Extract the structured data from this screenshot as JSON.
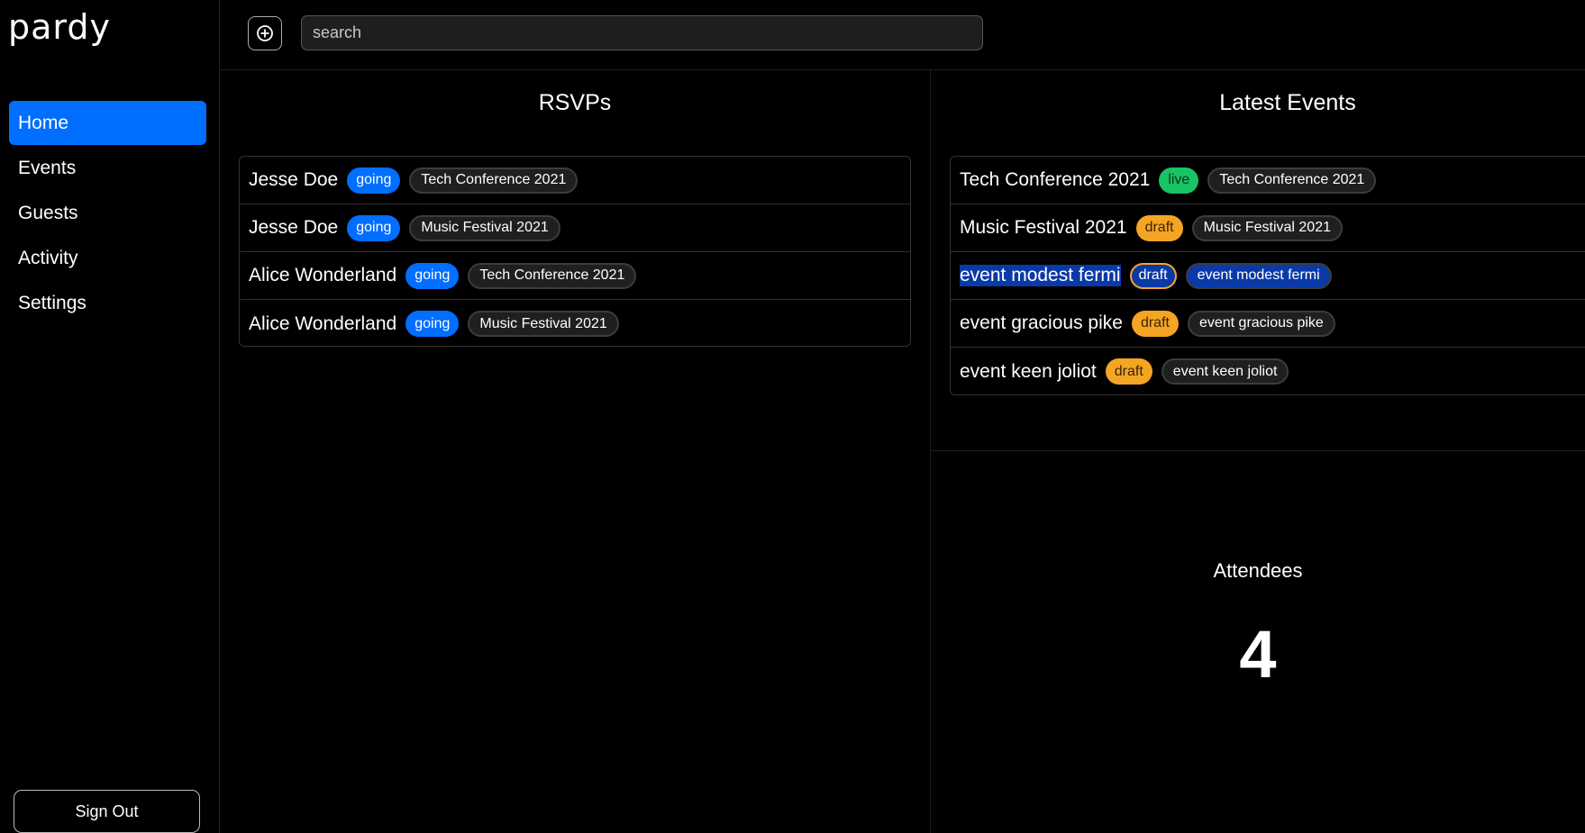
{
  "app": {
    "logo": "pardy"
  },
  "sidebar": {
    "items": [
      {
        "label": "Home",
        "active": true
      },
      {
        "label": "Events"
      },
      {
        "label": "Guests"
      },
      {
        "label": "Activity"
      },
      {
        "label": "Settings"
      }
    ],
    "sign_out": "Sign Out"
  },
  "topbar": {
    "add_icon": "plus-circle-icon",
    "search_placeholder": "search"
  },
  "rsvps": {
    "title": "RSVPs",
    "rows": [
      {
        "name": "Jesse Doe",
        "status": "going",
        "event": "Tech Conference 2021"
      },
      {
        "name": "Jesse Doe",
        "status": "going",
        "event": "Music Festival 2021"
      },
      {
        "name": "Alice Wonderland",
        "status": "going",
        "event": "Tech Conference 2021"
      },
      {
        "name": "Alice Wonderland",
        "status": "going",
        "event": "Music Festival 2021"
      }
    ]
  },
  "latest_events": {
    "title": "Latest Events",
    "rows": [
      {
        "name": "Tech Conference 2021",
        "status": "live",
        "tag": "Tech Conference 2021"
      },
      {
        "name": "Music Festival 2021",
        "status": "draft",
        "tag": "Music Festival 2021"
      },
      {
        "name": "event modest fermi",
        "status": "draft",
        "tag": "event modest fermi"
      },
      {
        "name": "event gracious pike",
        "status": "draft",
        "tag": "event gracious pike"
      },
      {
        "name": "event keen joliot",
        "status": "draft",
        "tag": "event keen joliot"
      }
    ]
  },
  "attendees": {
    "label": "Attendees",
    "count": "4"
  },
  "colors": {
    "accent": "#006efe",
    "live": "#18c463",
    "draft": "#f5a524"
  }
}
